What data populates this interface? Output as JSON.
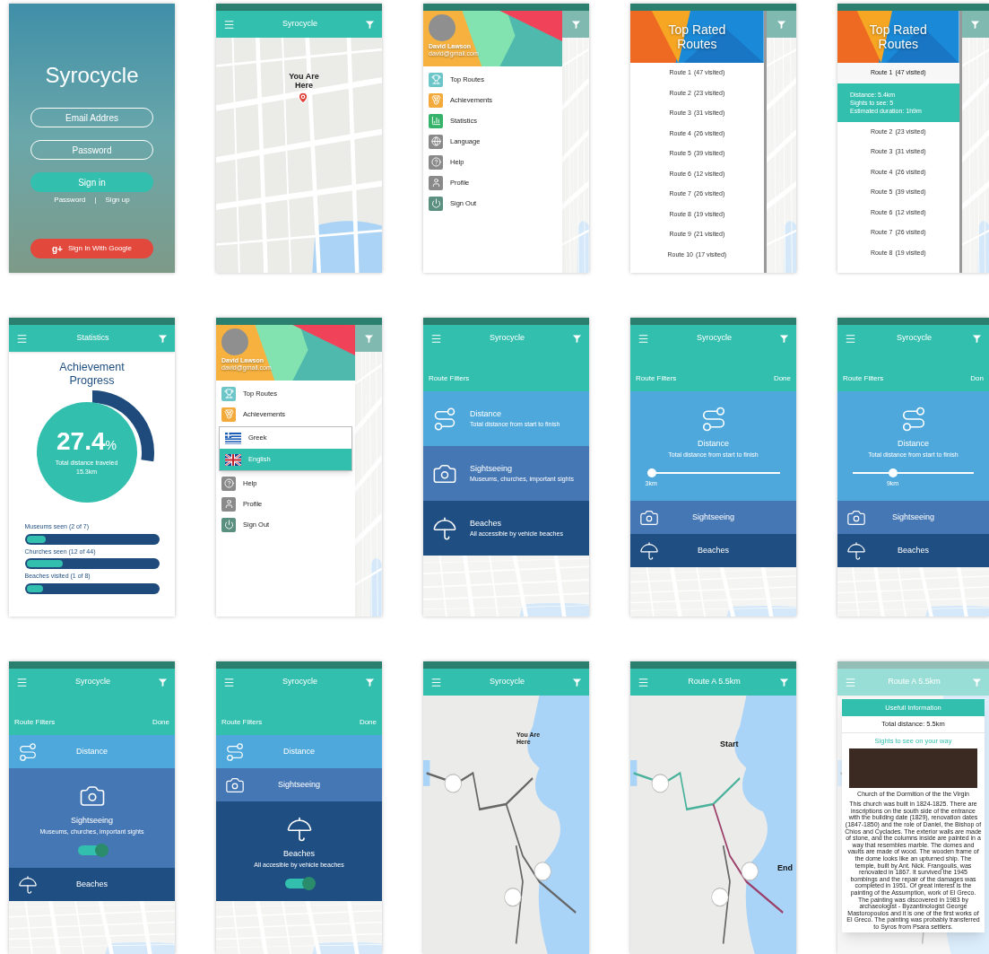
{
  "screens": [
    {
      "kind": "login",
      "title": "Syrocycle",
      "email_placeholder": "Email Addres",
      "password_placeholder": "Password",
      "sign_in": "Sign in",
      "links": [
        "Password",
        "Sign up"
      ],
      "separator": "|",
      "google_mark": "g+",
      "google": "Sign In With Google"
    },
    {
      "kind": "map",
      "title": "Syrocycle",
      "pin_label": "You Are Here"
    },
    {
      "kind": "drawer",
      "user_name": "David Lawson",
      "user_email": "david@gmail.com",
      "menu": [
        {
          "kind": "podium",
          "label": "Top Routes"
        },
        {
          "kind": "medal",
          "label": "Achievements"
        },
        {
          "kind": "chart",
          "label": "Statistics"
        },
        {
          "kind": "globe",
          "label": "Language"
        },
        {
          "kind": "help",
          "label": "Help"
        },
        {
          "kind": "person",
          "label": "Profile"
        },
        {
          "kind": "power",
          "label": "Sign Out"
        }
      ]
    },
    {
      "kind": "top_routes",
      "title": "Top Rated Routes",
      "routes": [
        {
          "name": "Route 1",
          "visits": "(47 visited)",
          "expanded": false
        },
        {
          "name": "Route 2",
          "visits": "(23 visited)",
          "expanded": false
        },
        {
          "name": "Route 3",
          "visits": "(31 visited)",
          "expanded": false
        },
        {
          "name": "Route 4",
          "visits": "(26 visited)",
          "expanded": false
        },
        {
          "name": "Route 5",
          "visits": "(39 visited)",
          "expanded": false
        },
        {
          "name": "Route 6",
          "visits": "(12 visited)",
          "expanded": false
        },
        {
          "name": "Route 7",
          "visits": "(26 visited)",
          "expanded": false
        },
        {
          "name": "Route 8",
          "visits": "(19 visited)",
          "expanded": false
        },
        {
          "name": "Route 9",
          "visits": "(21 visited)",
          "expanded": false
        },
        {
          "name": "Route 10",
          "visits": "(17 visited)",
          "expanded": false
        }
      ]
    },
    {
      "kind": "top_routes",
      "title": "Top Rated Routes",
      "routes": [
        {
          "name": "Route 1",
          "visits": "(47 visited)",
          "expanded": true,
          "details": [
            "Distance: 5.4km",
            "Sights to see: 5",
            "Estimated duration: 1h9m"
          ]
        },
        {
          "name": "Route 2",
          "visits": "(23 visited)",
          "expanded": false
        },
        {
          "name": "Route 3",
          "visits": "(31 visited)",
          "expanded": false
        },
        {
          "name": "Route 4",
          "visits": "(26 visited)",
          "expanded": false
        },
        {
          "name": "Route 5",
          "visits": "(39 visited)",
          "expanded": false
        },
        {
          "name": "Route 6",
          "visits": "(12 visited)",
          "expanded": false
        },
        {
          "name": "Route 7",
          "visits": "(26 visited)",
          "expanded": false
        },
        {
          "name": "Route 8",
          "visits": "(19 visited)",
          "expanded": false
        }
      ]
    },
    {
      "kind": "statistics",
      "title": "Statistics",
      "heading": "Achievement Progress",
      "percent": "27.4",
      "unit": "%",
      "caption": "Total distance traveled",
      "distance": "15.3km",
      "bars": [
        {
          "label": "Museums seen (2 of 7)",
          "level": 0.15
        },
        {
          "label": "Churches seen (12 of 44)",
          "level": 0.28
        },
        {
          "label": "Beaches visited (1 of 8)",
          "level": 0.13
        }
      ]
    },
    {
      "kind": "drawer",
      "user_name": "David Lawson",
      "user_email": "david@gmail.com",
      "menu": [
        {
          "kind": "podium",
          "label": "Top Routes"
        },
        {
          "kind": "medal",
          "label": "Achievements"
        },
        {
          "kind": "languages",
          "options": [
            {
              "kind": "greece",
              "label": "Greek",
              "selected": false
            },
            {
              "kind": "uk",
              "label": "English",
              "selected": true
            }
          ]
        },
        {
          "kind": "help",
          "label": "Help"
        },
        {
          "kind": "person",
          "label": "Profile"
        },
        {
          "kind": "power",
          "label": "Sign Out"
        }
      ]
    },
    {
      "kind": "filter_overview",
      "title": "Syrocycle",
      "heading": "Route Filters",
      "categories": [
        {
          "kind": "distance",
          "title": "Distance",
          "subtitle": "Total distance from start to finish"
        },
        {
          "kind": "sightseeing",
          "title": "Sightseeing",
          "subtitle": "Museums, churches, important sights"
        },
        {
          "kind": "beaches",
          "title": "Beaches",
          "subtitle": "All accessible by vehicle beaches"
        }
      ]
    },
    {
      "kind": "filter_detail",
      "title": "Syrocycle",
      "heading": "Route Filters",
      "done": "Done",
      "categories": [
        {
          "kind": "distance",
          "title": "Distance",
          "expanded": true,
          "subtitle": "Total distance from start to finish",
          "slider": {
            "level": 0,
            "reading": "3km"
          }
        },
        {
          "kind": "sightseeing",
          "title": "Sightseeing",
          "expanded": false
        },
        {
          "kind": "beaches",
          "title": "Beaches",
          "expanded": false
        }
      ]
    },
    {
      "kind": "filter_detail",
      "title": "Syrocycle",
      "heading": "Route Filters",
      "done": "Don",
      "categories": [
        {
          "kind": "distance",
          "title": "Distance",
          "expanded": true,
          "subtitle": "Total distance from start to finish",
          "slider": {
            "level": 0.32,
            "reading": "9km"
          }
        },
        {
          "kind": "sightseeing",
          "title": "Sightseeing",
          "expanded": false
        },
        {
          "kind": "beaches",
          "title": "Beaches",
          "expanded": false
        }
      ]
    },
    {
      "kind": "filter_detail",
      "title": "Syrocycle",
      "heading": "Route Filters",
      "done": "Done",
      "categories": [
        {
          "kind": "distance",
          "title": "Distance",
          "expanded": false
        },
        {
          "kind": "sightseeing",
          "title": "Sightseeing",
          "expanded": true,
          "subtitle": "Museums, churches, important sights",
          "on": true
        },
        {
          "kind": "beaches",
          "title": "Beaches",
          "expanded": false
        }
      ]
    },
    {
      "kind": "filter_detail",
      "title": "Syrocycle",
      "heading": "Route Filters",
      "done": "Done",
      "categories": [
        {
          "kind": "distance",
          "title": "Distance",
          "expanded": false
        },
        {
          "kind": "sightseeing",
          "title": "Sightseeing",
          "expanded": false
        },
        {
          "kind": "beaches",
          "title": "Beaches",
          "expanded": true,
          "subtitle": "All accesible by vehicle beaches",
          "on": true
        }
      ]
    },
    {
      "kind": "route_map",
      "title": "Syrocycle",
      "pin_label": "You Are Here"
    },
    {
      "kind": "route_map",
      "title": "Route A 5.5km",
      "start_label": "Start",
      "end_label": "End"
    },
    {
      "kind": "info",
      "title": "Route A 5.5km",
      "card_title": "Usefull Information",
      "total": "Total distance: 5.5km",
      "sights_link": "Sights to see on your way",
      "caption": "Church of the Dormition of the the Virgin",
      "text": "This church was built in 1824-1825. There are inscriptions on the south side of the entrance with the building date (1829), renovation dates (1847-1850) and the role of Daniel, the Bishop of Chios and Cyclades. The exterior walls are made of stone, and the columns inside are painted in a way that resembles marble. The domes and vaults are made of wood. The wooden frame of the dome looks like an upturned ship. The temple, built by Ant. Nick. Frangoulis, was renovated in 1867. It survived the 1945 bombings and the repair of the damages was completed in 1951. Of great interest is the painting of the Assumption, work of El Greco. The painting was discovered in 1983 by archaeologist - Byzantinologist George Mastoropoulos and it is one of the first works of El Greco. The painting was probably transferred to Syros from Psara settlers."
    }
  ]
}
